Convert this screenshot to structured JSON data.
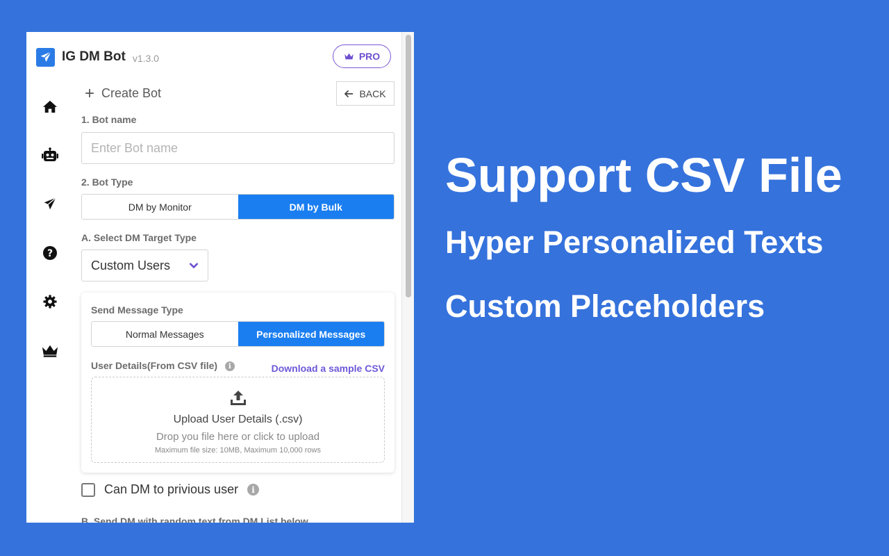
{
  "app": {
    "name": "IG DM Bot",
    "version": "v1.3.0",
    "pro_label": "PRO"
  },
  "nav": {
    "back_label": "BACK",
    "create_title": "Create Bot"
  },
  "sidebar": {
    "items": [
      "home-icon",
      "robot-icon",
      "send-icon",
      "help-icon",
      "settings-icon",
      "crown-icon"
    ]
  },
  "form": {
    "bot_name_label": "1. Bot name",
    "bot_name_placeholder": "Enter Bot name",
    "bot_type_label": "2. Bot Type",
    "bot_types": [
      "DM by Monitor",
      "DM by Bulk"
    ],
    "target_type_label": "A. Select DM Target Type",
    "target_type_value": "Custom Users",
    "message_type_label": "Send Message Type",
    "message_types": [
      "Normal Messages",
      "Personalized Messages"
    ],
    "user_details_label": "User Details(From CSV file)",
    "download_link": "Download a sample CSV",
    "upload_title": "Upload User Details (.csv)",
    "upload_sub": "Drop you file here or click to upload",
    "upload_hint": "Maximum file size: 10MB, Maximum 10,000 rows",
    "checkbox_label": "Can DM to privious user",
    "next_label": "B. Send DM with random text from DM List below"
  },
  "promo": {
    "headline": "Support CSV File",
    "line2": "Hyper Personalized Texts",
    "line3": "Custom Placeholders"
  },
  "colors": {
    "background": "#3572dc",
    "accent": "#1a7ef0",
    "pro": "#6d4fcf"
  }
}
